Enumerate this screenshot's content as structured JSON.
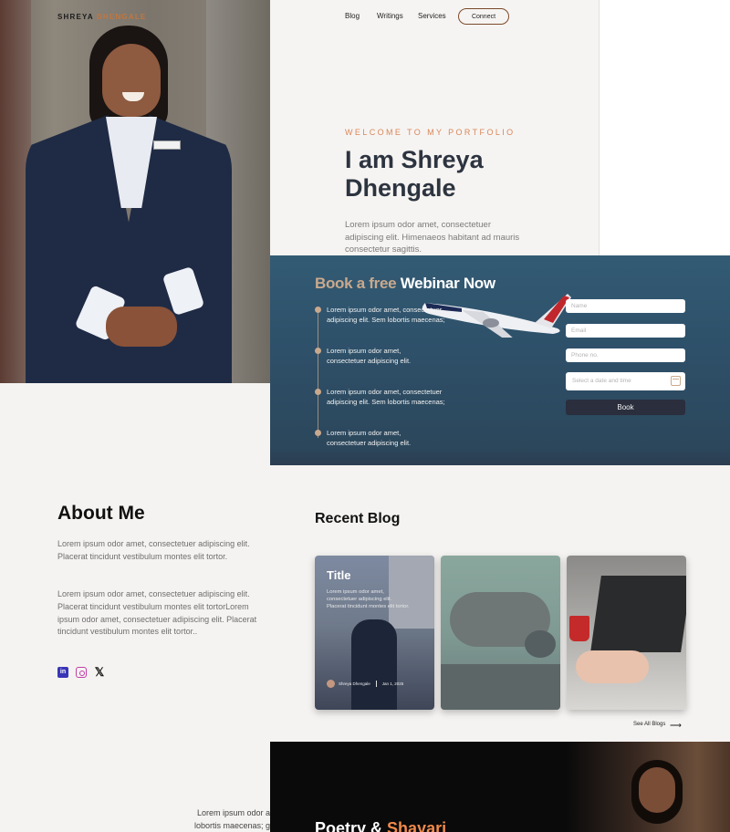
{
  "brand": {
    "first": "SHREYA",
    "second": "DHENGALE"
  },
  "nav": {
    "links": [
      "Blog",
      "Writings",
      "Services"
    ],
    "cta": "Connect"
  },
  "hero": {
    "eyebrow": "WELCOME TO MY PORTFOLIO",
    "title": "I am Shreya Dhengale",
    "description": "Lorem ipsum odor amet, consectetuer adipiscing elit. Himenaeos habitant ad mauris consectetur sagittis."
  },
  "webinar": {
    "title_part1": "Book a free",
    "title_part2": "Webinar Now",
    "points": [
      "Lorem ipsum odor amet, consectetuer adipiscing elit. Sem lobortis maecenas;",
      "Lorem ipsum odor amet, consectetuer adipiscing elit.",
      "Lorem ipsum odor amet, consectetuer adipiscing elit. Sem lobortis maecenas;",
      "Lorem ipsum odor amet, consectetuer adipiscing elit."
    ],
    "form": {
      "name_placeholder": "Name",
      "email_placeholder": "Email",
      "phone_placeholder": "Phone no.",
      "date_placeholder": "Select a date and time",
      "submit": "Book"
    }
  },
  "about": {
    "title": "About Me",
    "paragraphs": [
      "Lorem ipsum odor amet, consectetuer adipiscing elit. Placerat tincidunt vestibulum montes elit tortor.",
      "Lorem ipsum odor amet, consectetuer adipiscing elit. Placerat tincidunt vestibulum montes elit tortorLorem ipsum odor amet, consectetuer adipiscing elit. Placerat tincidunt vestibulum montes elit tortor.."
    ],
    "social": {
      "linkedin": "in",
      "x": "𝕏"
    }
  },
  "blog": {
    "title": "Recent Blog",
    "cards": [
      {
        "title": "Title",
        "excerpt": "Lorem ipsum odor amet, consectetuer adipiscing elit. Placerat tincidunt montes elit tortor.",
        "author": "Shreya Dhengale",
        "date": "Jan 1, 2025"
      }
    ],
    "see_all": "See All Blogs",
    "arrow": "⟶"
  },
  "poetry": {
    "title_part1": "Poetry &",
    "title_part2": "Shayari",
    "text_line1": "Lorem ipsum odor a",
    "text_line2": "lobortis maecenas; g"
  },
  "colors": {
    "accent": "#d8875a",
    "dark_navy": "#2d3440",
    "webinar_bg": "#2e5069",
    "book_button": "#2a2e3d",
    "linkedin": "#3a35b6",
    "instagram": "#c13da8"
  }
}
